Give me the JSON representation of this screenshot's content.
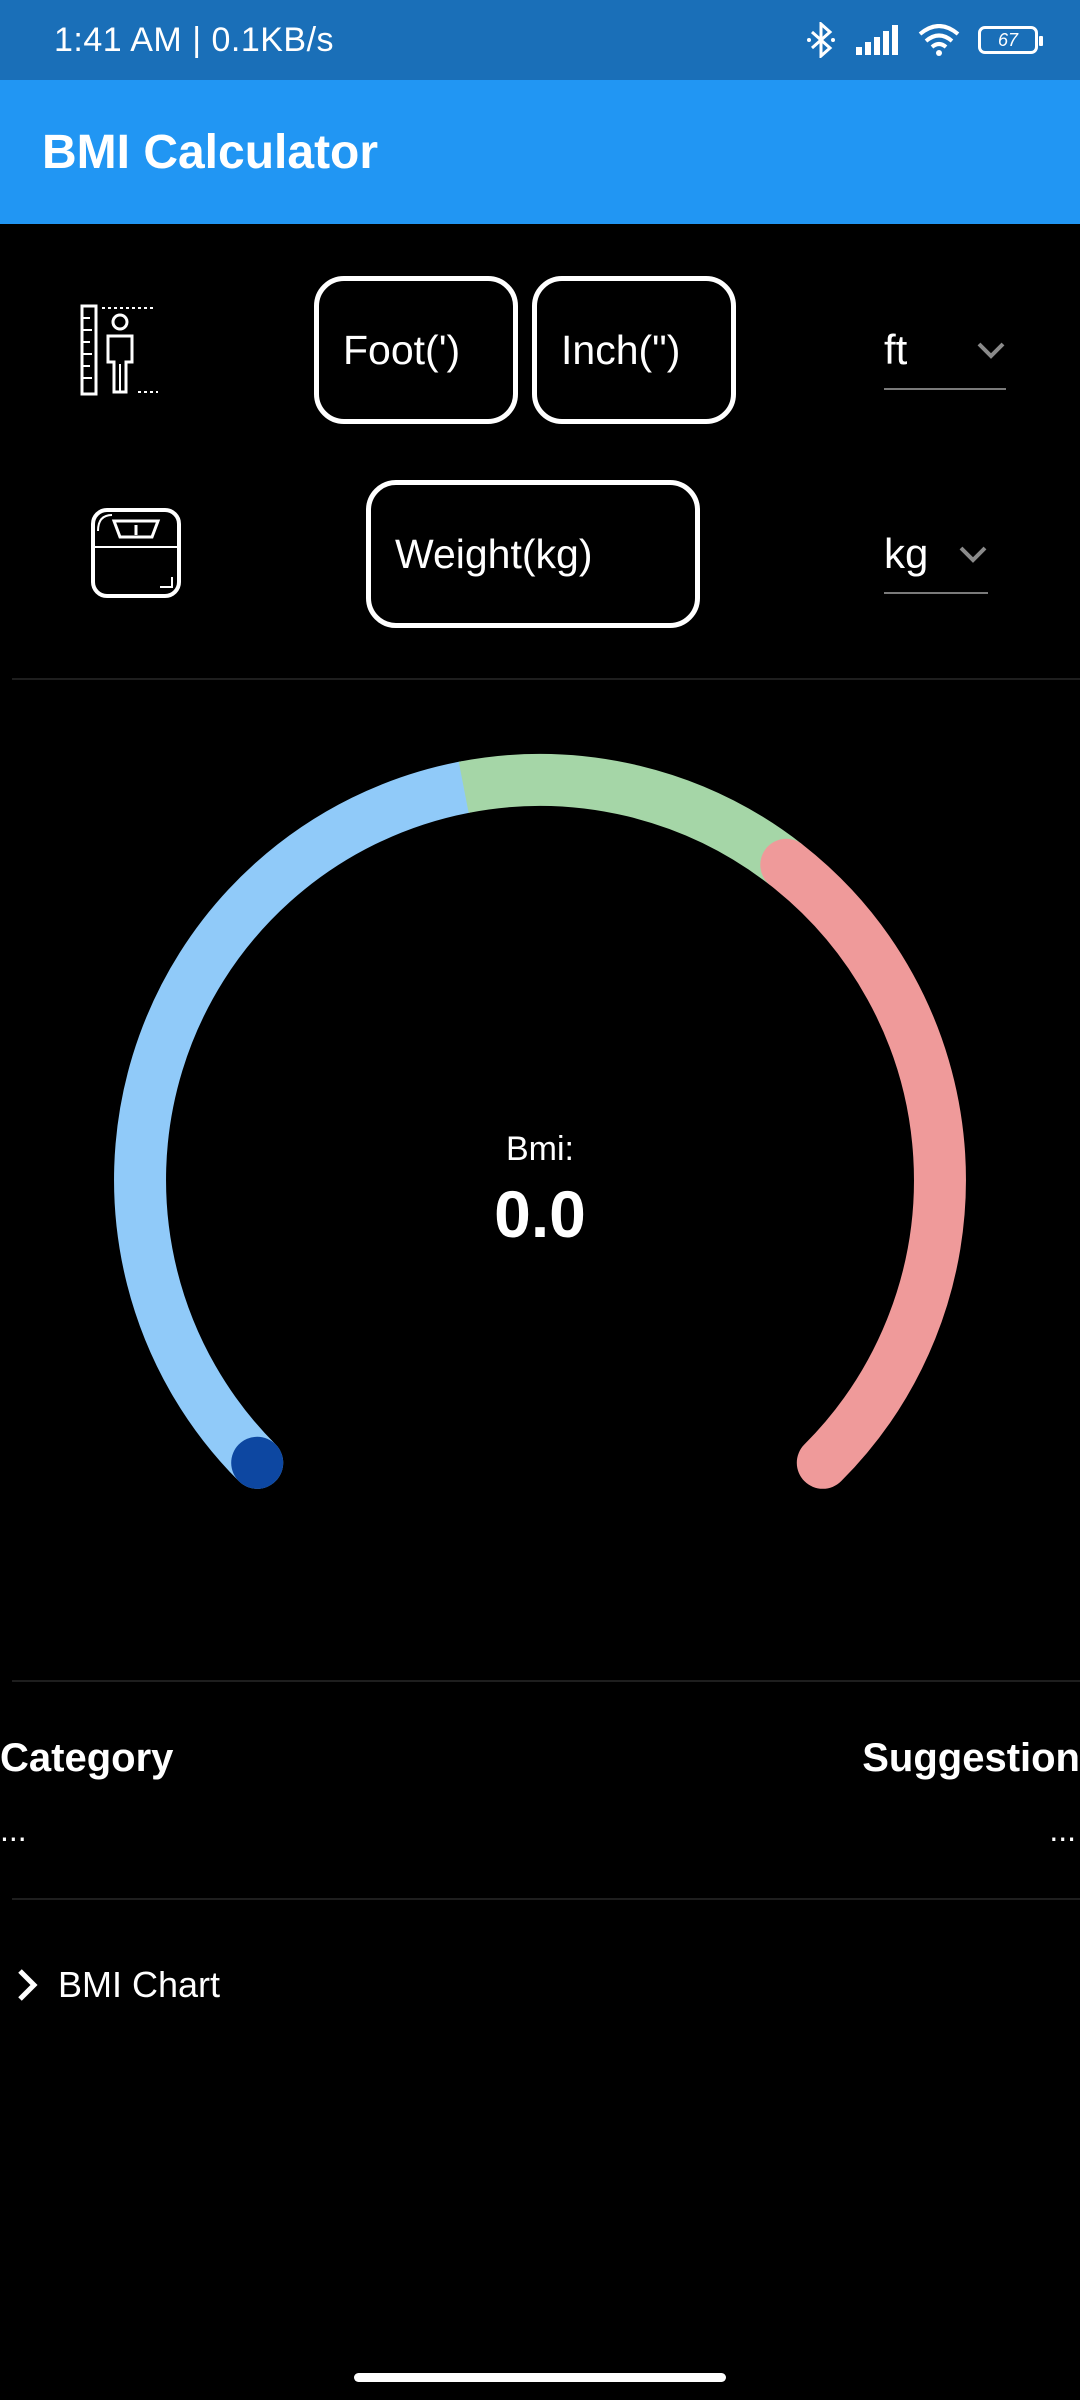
{
  "status_bar": {
    "time_speed": "1:41 AM | 0.1KB/s",
    "battery_level": "67",
    "icons": [
      "bluetooth-icon",
      "signal-icon",
      "wifi-icon",
      "battery-icon"
    ]
  },
  "app_bar": {
    "title": "BMI Calculator"
  },
  "height_row": {
    "icon": "height-measure-icon",
    "foot_placeholder": "Foot(')",
    "inch_placeholder": "Inch(\")",
    "unit": "ft"
  },
  "weight_row": {
    "icon": "weighing-scale-icon",
    "weight_placeholder": "Weight(kg)",
    "unit": "kg"
  },
  "gauge": {
    "label": "Bmi:",
    "value": "0.0",
    "colors": {
      "underweight": "#90caf9",
      "normal": "#a5d6a7",
      "overweight": "#ef9a9a",
      "pointer": "#0d47a1"
    }
  },
  "result": {
    "category_header": "Category",
    "category_value": "...",
    "suggestion_header": "Suggestion",
    "suggestion_value": "..."
  },
  "bmi_chart": {
    "label": "BMI Chart",
    "icon": "chevron-right-icon"
  },
  "colors": {
    "status_bar": "#1a6fb8",
    "app_bar": "#2196f3",
    "background": "#000000"
  }
}
